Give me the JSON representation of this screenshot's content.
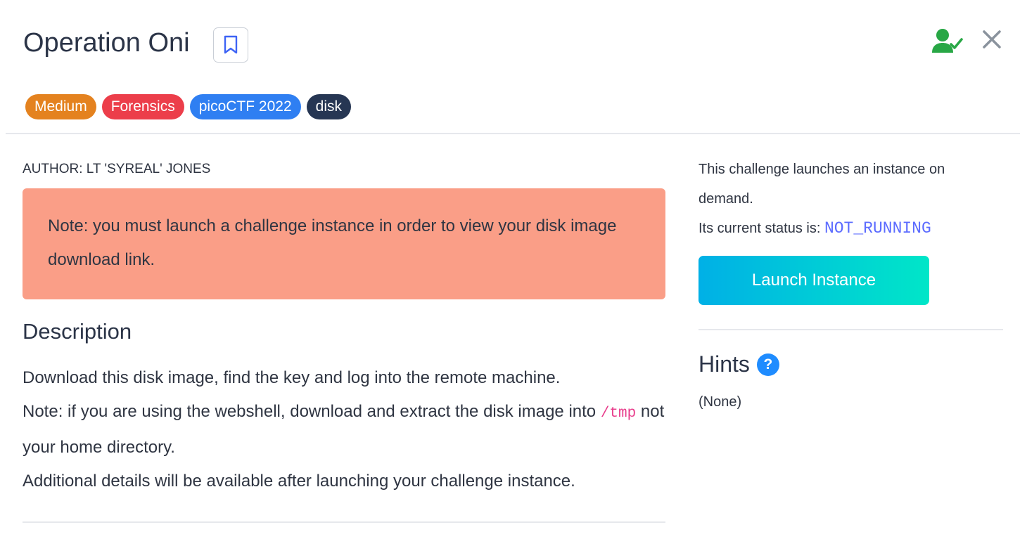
{
  "header": {
    "title": "Operation Oni",
    "icons": [
      "bookmark-icon",
      "user-check-icon",
      "close-icon"
    ]
  },
  "tags": [
    {
      "label": "Medium",
      "color": "#e4821f"
    },
    {
      "label": "Forensics",
      "color": "#ec3e4a"
    },
    {
      "label": "picoCTF 2022",
      "color": "#2f7ff2"
    },
    {
      "label": "disk",
      "color": "#263653"
    }
  ],
  "main": {
    "author": "AUTHOR: LT 'SYREAL' JONES",
    "alert": "Note: you must launch a challenge instance in order to view your disk image download link.",
    "description_title": "Description",
    "description": {
      "line1": "Download this disk image, find the key and log into the remote machine.",
      "line2_before": "Note: if you are using the webshell, download and extract the disk image into",
      "line2_code": "/tmp",
      "line2_after": "not your home directory.",
      "line3": "Additional details will be available after launching your challenge instance."
    }
  },
  "sidebar": {
    "instance_text": "This challenge launches an instance on demand.",
    "status_label": "Its current status is:",
    "status_value": "NOT_RUNNING",
    "launch_button": "Launch Instance",
    "hints_title": "Hints",
    "hints_help": "?",
    "hints_value": "(None)"
  },
  "colors": {
    "alert_bg": "#fa9e87",
    "status": "#5c6cff",
    "user_icon": "#28a745",
    "help_icon": "#1f8cff"
  }
}
